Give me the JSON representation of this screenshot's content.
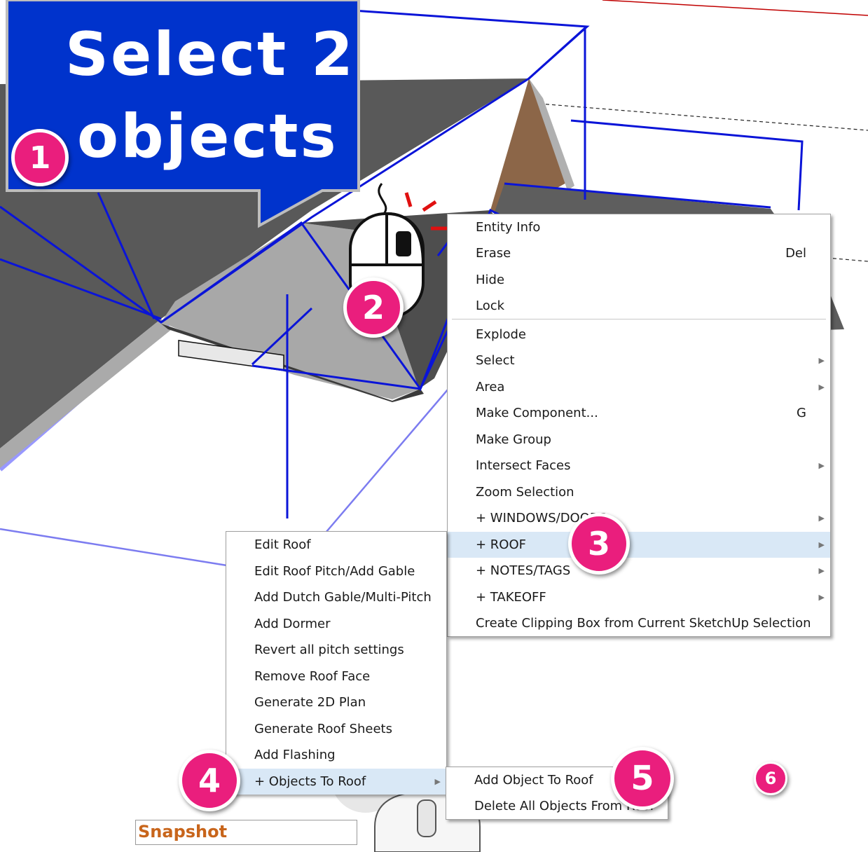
{
  "callout": {
    "line1": "Select 2",
    "line2": "objects"
  },
  "steps": [
    "1",
    "2",
    "3",
    "4",
    "5",
    "6"
  ],
  "context_menu": {
    "items": [
      {
        "label": "Entity Info",
        "shortcut": "",
        "submenu": false
      },
      {
        "label": "Erase",
        "shortcut": "Del",
        "submenu": false
      },
      {
        "label": "Hide",
        "shortcut": "",
        "submenu": false
      },
      {
        "label": "Lock",
        "shortcut": "",
        "submenu": false
      },
      {
        "label": "Explode",
        "shortcut": "",
        "submenu": false
      },
      {
        "label": "Select",
        "shortcut": "",
        "submenu": true
      },
      {
        "label": "Area",
        "shortcut": "",
        "submenu": true
      },
      {
        "label": "Make Component...",
        "shortcut": "G",
        "submenu": false
      },
      {
        "label": "Make Group",
        "shortcut": "",
        "submenu": false
      },
      {
        "label": "Intersect Faces",
        "shortcut": "",
        "submenu": true
      },
      {
        "label": "Zoom Selection",
        "shortcut": "",
        "submenu": false
      },
      {
        "label": "+ WINDOWS/DOORS",
        "shortcut": "",
        "submenu": true
      },
      {
        "label": "+ ROOF",
        "shortcut": "",
        "submenu": true,
        "highlighted": true
      },
      {
        "label": "+ NOTES/TAGS",
        "shortcut": "",
        "submenu": true
      },
      {
        "label": "+ TAKEOFF",
        "shortcut": "",
        "submenu": true
      },
      {
        "label": "Create Clipping Box from Current SketchUp Selection",
        "shortcut": "",
        "submenu": false
      }
    ]
  },
  "roof_menu": {
    "items": [
      {
        "label": "Edit Roof",
        "submenu": false
      },
      {
        "label": "Edit Roof Pitch/Add Gable",
        "submenu": false
      },
      {
        "label": "Add Dutch Gable/Multi-Pitch",
        "submenu": false
      },
      {
        "label": "Add Dormer",
        "submenu": false
      },
      {
        "label": "Revert all pitch settings",
        "submenu": false
      },
      {
        "label": "Remove Roof Face",
        "submenu": false
      },
      {
        "label": "Generate 2D Plan",
        "submenu": false
      },
      {
        "label": "Generate Roof Sheets",
        "submenu": false
      },
      {
        "label": "Add Flashing",
        "submenu": false
      },
      {
        "label": "+ Objects To Roof",
        "submenu": true,
        "highlighted": true
      }
    ]
  },
  "objects_menu": {
    "items": [
      {
        "label": "Add Object To Roof"
      },
      {
        "label": "Delete All Objects From Roof"
      }
    ]
  },
  "snapshot": {
    "label": "Snapshot"
  },
  "colors": {
    "callout": "#0033cc",
    "badge": "#ea1e7d",
    "highlight": "#d9e8f6",
    "selection": "#0a14d8",
    "roof": "#5a5a5a"
  }
}
